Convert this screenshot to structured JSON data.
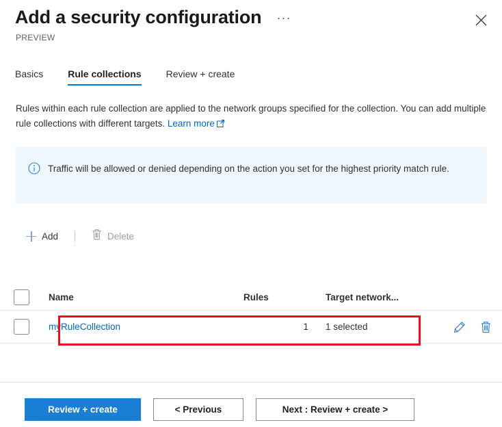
{
  "header": {
    "title": "Add a security configuration",
    "preview_label": "PREVIEW",
    "ellipsis_label": "···",
    "close_icon": "close-icon",
    "more_icon": "ellipsis-icon"
  },
  "tabs": [
    {
      "label": "Basics",
      "active": false
    },
    {
      "label": "Rule collections",
      "active": true
    },
    {
      "label": "Review + create",
      "active": false
    }
  ],
  "description": {
    "text": "Rules within each rule collection are applied to the network groups specified for the collection. You can add multiple rule collections with different targets.",
    "link_label": "Learn more",
    "link_icon": "external-link-icon"
  },
  "info_banner": {
    "icon": "info-circle-icon",
    "text": "Traffic will be allowed or denied depending on the action you set for the highest priority match rule."
  },
  "commandbar": {
    "add": {
      "label": "Add",
      "icon": "plus-icon",
      "enabled": true
    },
    "delete": {
      "label": "Delete",
      "icon": "trash-icon",
      "enabled": false
    }
  },
  "table": {
    "columns": [
      "Name",
      "Rules",
      "Target network..."
    ],
    "select_all_checkbox": "unchecked",
    "rows": [
      {
        "checkbox": "unchecked",
        "name": "myRuleCollection",
        "rules": "1",
        "target_networks": "1 selected",
        "edit_icon": "pencil-icon",
        "delete_icon": "trash-icon",
        "highlighted": true
      }
    ]
  },
  "footer": {
    "primary": "Review + create",
    "previous": "< Previous",
    "next": "Next : Review + create >"
  },
  "colors": {
    "accent": "#0078d4",
    "link": "#0066cc",
    "primary_button": "#1a7fd4",
    "info_background": "#eff6fc",
    "annotation": "#e81123",
    "plus_icon": "#8c9ed3",
    "disabled_text": "#a19f9d"
  }
}
